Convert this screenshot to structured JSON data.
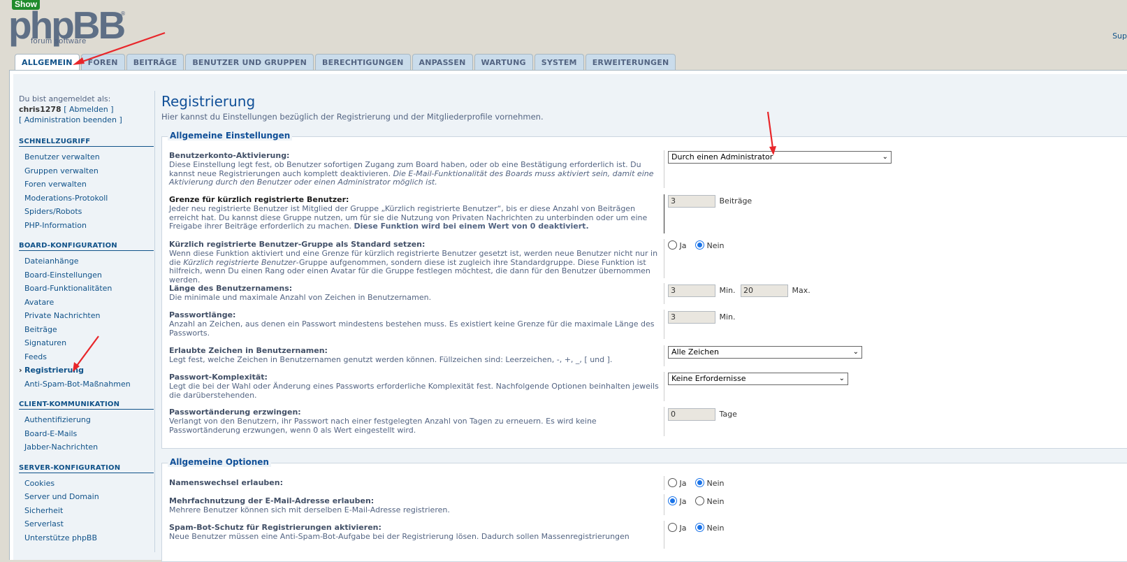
{
  "badge": "Show",
  "logo": {
    "main": "phpBB",
    "sub": "forum  software",
    "reg": "®"
  },
  "top_link": "Sup",
  "tabs": [
    {
      "label": "ALLGEMEIN"
    },
    {
      "label": "FOREN"
    },
    {
      "label": "BEITRÄGE"
    },
    {
      "label": "BENUTZER UND GRUPPEN"
    },
    {
      "label": "BERECHTIGUNGEN"
    },
    {
      "label": "ANPASSEN"
    },
    {
      "label": "WARTUNG"
    },
    {
      "label": "SYSTEM"
    },
    {
      "label": "ERWEITERUNGEN"
    }
  ],
  "sidebar": {
    "logged_in_as": "Du bist angemeldet als:",
    "username": "chris1278",
    "logout": "[ Abmelden ]",
    "admin_end": "[ Administration beenden ]",
    "sections": [
      {
        "title": "SCHNELLZUGRIFF",
        "items": [
          "Benutzer verwalten",
          "Gruppen verwalten",
          "Foren verwalten",
          "Moderations-Protokoll",
          "Spiders/Robots",
          "PHP-Information"
        ]
      },
      {
        "title": "BOARD-KONFIGURATION",
        "items": [
          "Dateianhänge",
          "Board-Einstellungen",
          "Board-Funktionalitäten",
          "Avatare",
          "Private Nachrichten",
          "Beiträge",
          "Signaturen",
          "Feeds",
          "Registrierung",
          "Anti-Spam-Bot-Maßnahmen"
        ]
      },
      {
        "title": "CLIENT-KOMMUNIKATION",
        "items": [
          "Authentifizierung",
          "Board-E-Mails",
          "Jabber-Nachrichten"
        ]
      },
      {
        "title": "SERVER-KONFIGURATION",
        "items": [
          "Cookies",
          "Server und Domain",
          "Sicherheit",
          "Serverlast",
          "Unterstütze phpBB"
        ]
      }
    ]
  },
  "main": {
    "title": "Registrierung",
    "intro": "Hier kannst du Einstellungen bezüglich der Registrierung und der Mitgliederprofile vornehmen.",
    "fs1": {
      "legend": "Allgemeine Einstellungen",
      "activation": {
        "label": "Benutzerkonto-Aktivierung:",
        "desc": "Diese Einstellung legt fest, ob Benutzer sofortigen Zugang zum Board haben, oder ob eine Bestätigung erforderlich ist. Du kannst neue Registrierungen auch komplett deaktivieren.",
        "desc_italic": "Die E-Mail-Funktionalität des Boards muss aktiviert sein, damit eine Aktivierung durch den Benutzer oder einen Administrator möglich ist.",
        "value": "Durch einen Administrator"
      },
      "new_member": {
        "label": "Grenze für kürzlich registrierte Benutzer:",
        "desc": "Jeder neu registrierte Benutzer ist Mitglied der Gruppe „Kürzlich registrierte Benutzer“, bis er diese Anzahl von Beiträgen erreicht hat. Du kannst diese Gruppe nutzen, um für sie die Nutzung von Privaten Nachrichten zu unterbinden oder um eine Freigabe ihrer Beiträge erforderlich zu machen.",
        "desc_bold": "Diese Funktion wird bei einem Wert von 0 deaktiviert.",
        "value": "3",
        "unit": "Beiträge"
      },
      "default_group": {
        "label": "Kürzlich registrierte Benutzer-Gruppe als Standard setzen:",
        "desc_a": "Wenn diese Funktion aktiviert und eine Grenze für kürzlich registrierte Benutzer gesetzt ist, werden neue Benutzer nicht nur in die",
        "desc_i": "Kürzlich registrierte Benutzer",
        "desc_b": "-Gruppe aufgenommen, sondern diese ist zugleich ihre Standardgruppe. Diese Funktion ist hilfreich, wenn Du einen Rang oder einen Avatar für die Gruppe festlegen möchtest, die dann für den Benutzer übernommen werden.",
        "yes": "Ja",
        "no": "Nein"
      },
      "username_length": {
        "label": "Länge des Benutzernamens:",
        "desc": "Die minimale und maximale Anzahl von Zeichen in Benutzernamen.",
        "min": "3",
        "min_label": "Min.",
        "max": "20",
        "max_label": "Max."
      },
      "password_length": {
        "label": "Passwortlänge:",
        "desc": "Anzahl an Zeichen, aus denen ein Passwort mindestens bestehen muss. Es existiert keine Grenze für die maximale Länge des Passworts.",
        "min": "3",
        "min_label": "Min."
      },
      "allowed_chars": {
        "label": "Erlaubte Zeichen in Benutzernamen:",
        "desc": "Legt fest, welche Zeichen in Benutzernamen genutzt werden können. Füllzeichen sind: Leerzeichen, -, +, _, [ und ].",
        "value": "Alle Zeichen"
      },
      "complexity": {
        "label": "Passwort-Komplexität:",
        "desc": "Legt die bei der Wahl oder Änderung eines Passworts erforderliche Komplexität fest. Nachfolgende Optionen beinhalten jeweils die darüberstehenden.",
        "value": "Keine Erfordernisse"
      },
      "force_change": {
        "label": "Passwortänderung erzwingen:",
        "desc": "Verlangt von den Benutzern, ihr Passwort nach einer festgelegten Anzahl von Tagen zu erneuern. Es wird keine Passwortänderung erzwungen, wenn 0 als Wert eingestellt wird.",
        "value": "0",
        "unit": "Tage"
      }
    },
    "fs2": {
      "legend": "Allgemeine Optionen",
      "namechange": {
        "label": "Namenswechsel erlauben:",
        "yes": "Ja",
        "no": "Nein"
      },
      "email_reuse": {
        "label": "Mehrfachnutzung der E-Mail-Adresse erlauben:",
        "desc": "Mehrere Benutzer können sich mit derselben E-Mail-Adresse registrieren.",
        "yes": "Ja",
        "no": "Nein"
      },
      "spambot": {
        "label": "Spam-Bot-Schutz für Registrierungen aktivieren:",
        "desc": "Neue Benutzer müssen eine Anti-Spam-Bot-Aufgabe bei der Registrierung lösen. Dadurch sollen Massenregistrierungen",
        "yes": "Ja",
        "no": "Nein"
      }
    }
  }
}
